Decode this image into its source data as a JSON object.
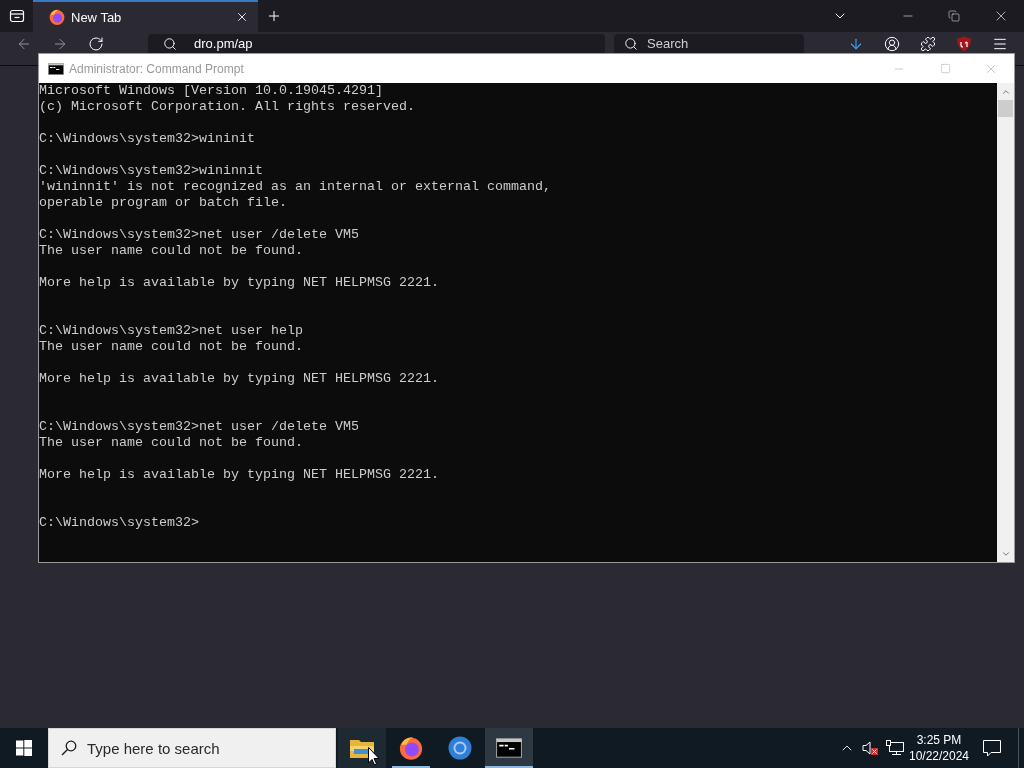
{
  "browser": {
    "tabs": [
      {
        "title": "New Tab",
        "selected": true
      }
    ],
    "address_bar": {
      "value": "dro.pm/ap"
    },
    "search_field": {
      "placeholder": "Search"
    }
  },
  "console_window": {
    "title": "Administrator: Command Prompt",
    "lines": [
      {
        "kind": "text",
        "text": "Microsoft Windows [Version 10.0.19045.4291]"
      },
      {
        "kind": "text",
        "text": "(c) Microsoft Corporation. All rights reserved."
      },
      {
        "kind": "blank"
      },
      {
        "kind": "text",
        "text": "C:\\Windows\\system32>wininit"
      },
      {
        "kind": "blank"
      },
      {
        "kind": "text",
        "text": "C:\\Windows\\system32>wininnit"
      },
      {
        "kind": "text",
        "text": "'wininnit' is not recognized as an internal or external command,"
      },
      {
        "kind": "text",
        "text": "operable program or batch file."
      },
      {
        "kind": "blank"
      },
      {
        "kind": "text",
        "text": "C:\\Windows\\system32>net user /delete VM5"
      },
      {
        "kind": "text",
        "text": "The user name could not be found."
      },
      {
        "kind": "blank"
      },
      {
        "kind": "text",
        "text": "More help is available by typing NET HELPMSG 2221."
      },
      {
        "kind": "blank"
      },
      {
        "kind": "blank"
      },
      {
        "kind": "text",
        "text": "C:\\Windows\\system32>net user help"
      },
      {
        "kind": "text",
        "text": "The user name could not be found."
      },
      {
        "kind": "blank"
      },
      {
        "kind": "text",
        "text": "More help is available by typing NET HELPMSG 2221."
      },
      {
        "kind": "blank"
      },
      {
        "kind": "blank"
      },
      {
        "kind": "text",
        "text": "C:\\Windows\\system32>net user /delete VM5"
      },
      {
        "kind": "text",
        "text": "The user name could not be found."
      },
      {
        "kind": "blank"
      },
      {
        "kind": "text",
        "text": "More help is available by typing NET HELPMSG 2221."
      },
      {
        "kind": "blank"
      },
      {
        "kind": "blank"
      },
      {
        "kind": "text",
        "text": "C:\\Windows\\system32>"
      }
    ]
  },
  "taskbar": {
    "search_box": {
      "placeholder": "Type here to search"
    },
    "apps": [
      {
        "kind": "folder",
        "running": false,
        "selected": false,
        "hovered": true
      },
      {
        "kind": "fox-logo",
        "running": true,
        "selected": false,
        "hovered": false
      },
      {
        "kind": "ring-logo",
        "running": false,
        "selected": false,
        "hovered": false
      },
      {
        "kind": "terminal",
        "running": true,
        "selected": true,
        "hovered": false
      }
    ],
    "volume": {
      "muted": true
    },
    "clock": {
      "time": "3:25 PM",
      "date": "10/22/2024"
    }
  }
}
